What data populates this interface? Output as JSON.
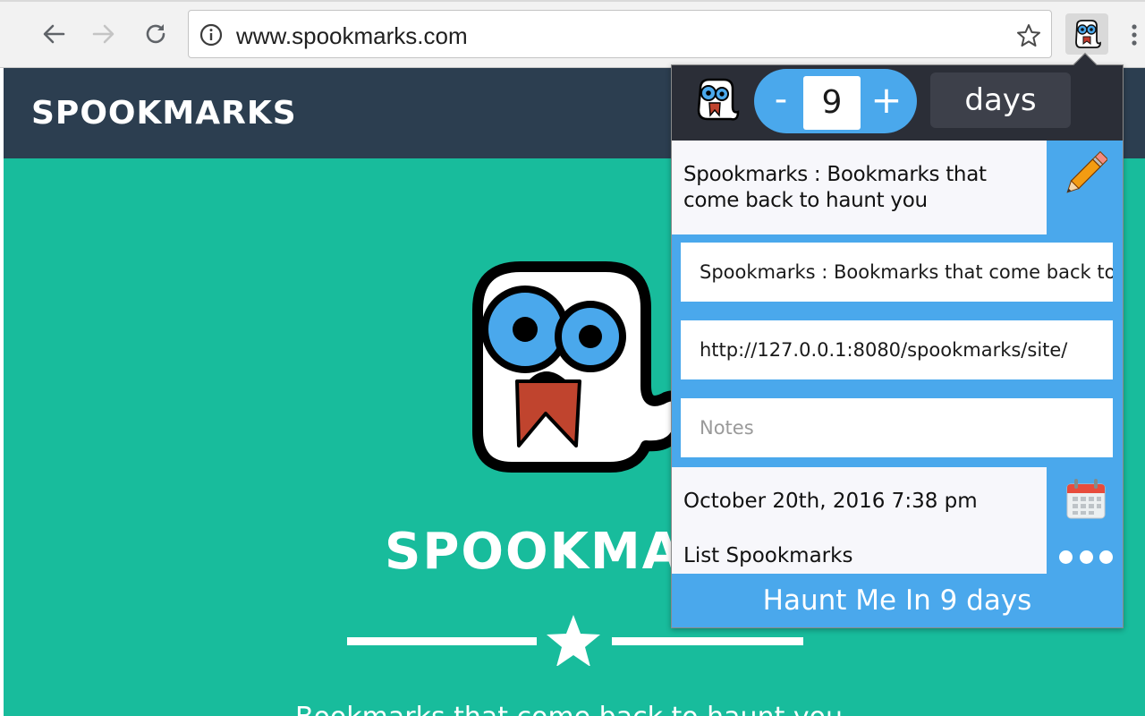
{
  "browser": {
    "url": "www.spookmarks.com",
    "icons": {
      "back": "back-arrow-icon",
      "forward": "forward-arrow-icon",
      "reload": "reload-icon",
      "info": "info-icon",
      "bookmark": "star-icon",
      "extension": "spookmarks-ghost-icon",
      "menu": "kebab-menu-icon"
    }
  },
  "site": {
    "brand": "SPOOKMARKS",
    "hero_title": "SPOOKMARKS",
    "tagline": "Bookmarks that come back to haunt you",
    "colors": {
      "navbar": "#2c3e50",
      "hero": "#18bc9c"
    }
  },
  "popup": {
    "count": "9",
    "minus_label": "-",
    "plus_label": "+",
    "unit": "days",
    "page_title": "Spookmarks : Bookmarks that come back to haunt you",
    "title_field": "Spookmarks : Bookmarks that come back to haunt you",
    "url_field": "http://127.0.0.1:8080/spookmarks/site/",
    "notes_placeholder": "Notes",
    "date": "October 20th, 2016 7:38 pm",
    "list_link": "List Spookmarks",
    "haunt_button": "Haunt Me In 9 days",
    "colors": {
      "accent": "#4aa8ec",
      "header": "#2b2e37",
      "unit_bg": "#3d404a"
    }
  }
}
